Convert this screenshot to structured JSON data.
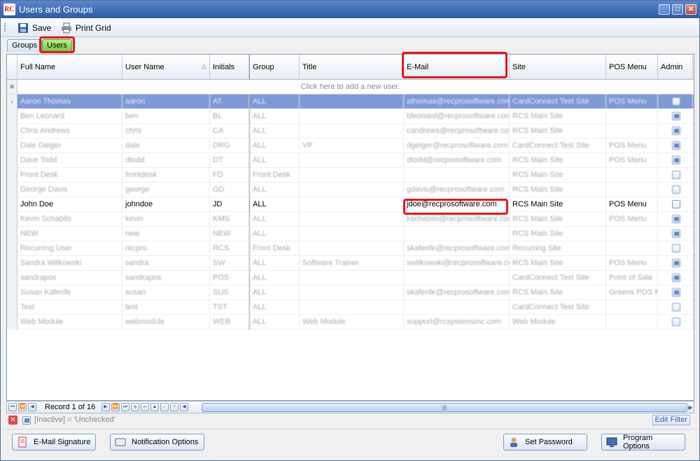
{
  "window": {
    "title": "Users and Groups",
    "app_icon_text": "RC"
  },
  "toolbar": {
    "save_label": "Save",
    "print_label": "Print Grid"
  },
  "tabs": [
    {
      "label": "Groups"
    },
    {
      "label": "Users"
    }
  ],
  "grid": {
    "columns": [
      {
        "label": "Full Name"
      },
      {
        "label": "User Name"
      },
      {
        "label": "Initials"
      },
      {
        "label": "Group"
      },
      {
        "label": "Title"
      },
      {
        "label": "E-Mail"
      },
      {
        "label": "Site"
      },
      {
        "label": "POS Menu"
      },
      {
        "label": "Admin"
      }
    ],
    "new_row_text": "Click here to add a new user.",
    "rows": [
      {
        "full_name": "Aaron Thomas",
        "user_name": "aaron",
        "initials": "AT",
        "group": "ALL",
        "title": "",
        "email": "athomas@recprosoftware.com",
        "site": "CardConnect Test Site",
        "pos_menu": "POS Menu",
        "admin": false
      },
      {
        "full_name": "Ben Leonard",
        "user_name": "ben",
        "initials": "BL",
        "group": "ALL",
        "title": "",
        "email": "bleonard@recprosoftware.com",
        "site": "RCS Main Site",
        "pos_menu": "",
        "admin": true
      },
      {
        "full_name": "Chris Andrews",
        "user_name": "chris",
        "initials": "CA",
        "group": "ALL",
        "title": "",
        "email": "candrews@recprosoftware.com",
        "site": "RCS Main Site",
        "pos_menu": "",
        "admin": true
      },
      {
        "full_name": "Dale Geiger",
        "user_name": "dale",
        "initials": "DRG",
        "group": "ALL",
        "title": "VP",
        "email": "dgeiger@recprosoftware.com",
        "site": "CardConnect Test Site",
        "pos_menu": "POS Menu",
        "admin": true
      },
      {
        "full_name": "Dave Todd",
        "user_name": "dtodd",
        "initials": "DT",
        "group": "ALL",
        "title": "",
        "email": "dtodd@recprosoftware.com",
        "site": "RCS Main Site",
        "pos_menu": "POS Menu",
        "admin": true
      },
      {
        "full_name": "Front Desk",
        "user_name": "frontdesk",
        "initials": "FD",
        "group": "Front Desk",
        "title": "",
        "email": "",
        "site": "RCS Main Site",
        "pos_menu": "",
        "admin": false
      },
      {
        "full_name": "George Davis",
        "user_name": "george",
        "initials": "GD",
        "group": "ALL",
        "title": "",
        "email": "gdavis@recprosoftware.com",
        "site": "RCS Main Site",
        "pos_menu": "",
        "admin": false
      },
      {
        "full_name": "John Doe",
        "user_name": "johndoe",
        "initials": "JD",
        "group": "ALL",
        "title": "",
        "email": "jdoe@recprosoftware.com",
        "site": "RCS Main Site",
        "pos_menu": "POS Menu",
        "admin": false
      },
      {
        "full_name": "Kevin Schabilo",
        "user_name": "kevin",
        "initials": "KMS",
        "group": "ALL",
        "title": "",
        "email": "kschabilo@recprosoftware.com",
        "site": "RCS Main Site",
        "pos_menu": "POS Menu",
        "admin": true
      },
      {
        "full_name": "NEW",
        "user_name": "new",
        "initials": "NEW",
        "group": "ALL",
        "title": "",
        "email": "",
        "site": "RCS Main Site",
        "pos_menu": "",
        "admin": true
      },
      {
        "full_name": "Recurring User",
        "user_name": "recpro",
        "initials": "RCS",
        "group": "Front Desk",
        "title": "",
        "email": "skafenfe@recprosoftware.com",
        "site": "Recurring Site",
        "pos_menu": "",
        "admin": false
      },
      {
        "full_name": "Sandra Witkowski",
        "user_name": "sandra",
        "initials": "SW",
        "group": "ALL",
        "title": "Software Trainer",
        "email": "switkowski@recprosoftware.com",
        "site": "RCS Main Site",
        "pos_menu": "POS Menu",
        "admin": true
      },
      {
        "full_name": "sandrapos",
        "user_name": "sandrapos",
        "initials": "POS",
        "group": "ALL",
        "title": "",
        "email": "",
        "site": "CardConnect Test Site",
        "pos_menu": "Point of Sale",
        "admin": true
      },
      {
        "full_name": "Susan Kafenfe",
        "user_name": "susan",
        "initials": "SUS",
        "group": "ALL",
        "title": "",
        "email": "skafenfe@recprosoftware.com",
        "site": "RCS Main Site",
        "pos_menu": "Greens POS Menu",
        "admin": true
      },
      {
        "full_name": "Test",
        "user_name": "test",
        "initials": "TST",
        "group": "ALL",
        "title": "",
        "email": "",
        "site": "CardConnect Test Site",
        "pos_menu": "",
        "admin": false
      },
      {
        "full_name": "Web Module",
        "user_name": "webmodule",
        "initials": "WEB",
        "group": "ALL",
        "title": "Web Module",
        "email": "support@rcsystemsinc.com",
        "site": "Web Module",
        "pos_menu": "",
        "admin": false
      }
    ]
  },
  "navigator": {
    "record_label": "Record 1 of 16"
  },
  "filter": {
    "text": "[Inactive] = 'Unchecked'",
    "edit_label": "Edit Filter"
  },
  "buttons": {
    "email_signature": "E-Mail Signature",
    "notification_options": "Notification Options",
    "set_password": "Set Password",
    "program_options": "Program Options"
  },
  "colors": {
    "highlight": "#e8161a",
    "selected_row": "#7f98d8",
    "active_tab": "#6cc641"
  }
}
